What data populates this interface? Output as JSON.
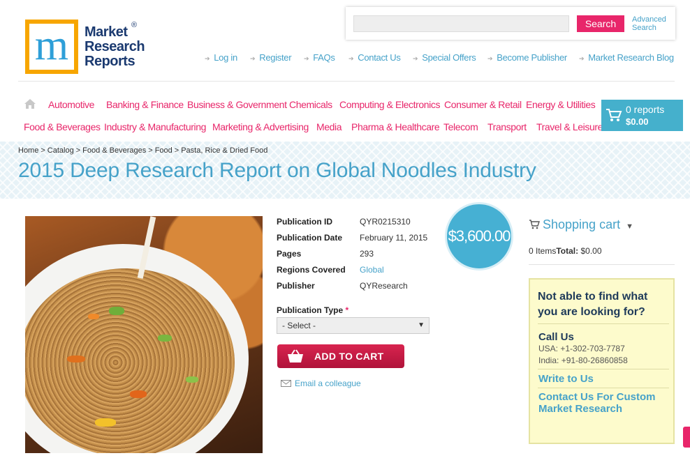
{
  "logo": {
    "line1": "Market",
    "line2": "Research",
    "line3": "Reports",
    "reg": "®"
  },
  "search": {
    "placeholder": "",
    "button": "Search",
    "advanced_line1": "Advanced",
    "advanced_line2": "Search"
  },
  "top_links": [
    "Log in",
    "Register",
    "FAQs",
    "Contact Us",
    "Special Offers",
    "Become Publisher",
    "Market Research Blog"
  ],
  "categories_row1": [
    "Automotive",
    "Banking & Finance",
    "Business & Government",
    "Chemicals",
    "Computing & Electronics",
    "Consumer & Retail",
    "Energy & Utilities"
  ],
  "categories_row2": [
    "Food & Beverages",
    "Industry & Manufacturing",
    "Marketing & Advertising",
    "Media",
    "Pharma & Healthcare",
    "Telecom",
    "Transport",
    "Travel & Leisure"
  ],
  "cart": {
    "reports": "0 reports",
    "total": "$0.00"
  },
  "breadcrumb": [
    "Home",
    ">",
    "Catalog",
    ">",
    "Food & Beverages",
    ">",
    "Food",
    ">",
    "Pasta, Rice & Dried Food"
  ],
  "title": "2015 Deep Research Report on Global Noodles Industry",
  "details": [
    {
      "label": "Publication ID",
      "value": "QYR0215310"
    },
    {
      "label": "Publication Date",
      "value": "February 11, 2015"
    },
    {
      "label": "Pages",
      "value": "293"
    },
    {
      "label": "Regions Covered",
      "value": "Global"
    },
    {
      "label": "Publisher",
      "value": "QYResearch"
    }
  ],
  "publication_type": {
    "label": "Publication Type",
    "required": "*",
    "selected": "- Select -"
  },
  "add_to_cart": "ADD TO CART",
  "email_colleague": "Email a colleague",
  "price": "$3,600.00",
  "shopping_cart": {
    "title": "Shopping cart",
    "items": "0 Items",
    "total_label": "Total:",
    "total_value": " $0.00"
  },
  "help": {
    "question": "Not able to find what you are looking for?",
    "call_us": "Call Us",
    "usa": "USA: +1-302-703-7787",
    "india": "India: +91-80-26860858",
    "write": "Write to Us",
    "custom": "Contact Us For Custom Market Research"
  },
  "colors": {
    "accent_pink": "#e8266a",
    "accent_blue": "#46a2c9",
    "help_bg": "#fdfbcc"
  }
}
